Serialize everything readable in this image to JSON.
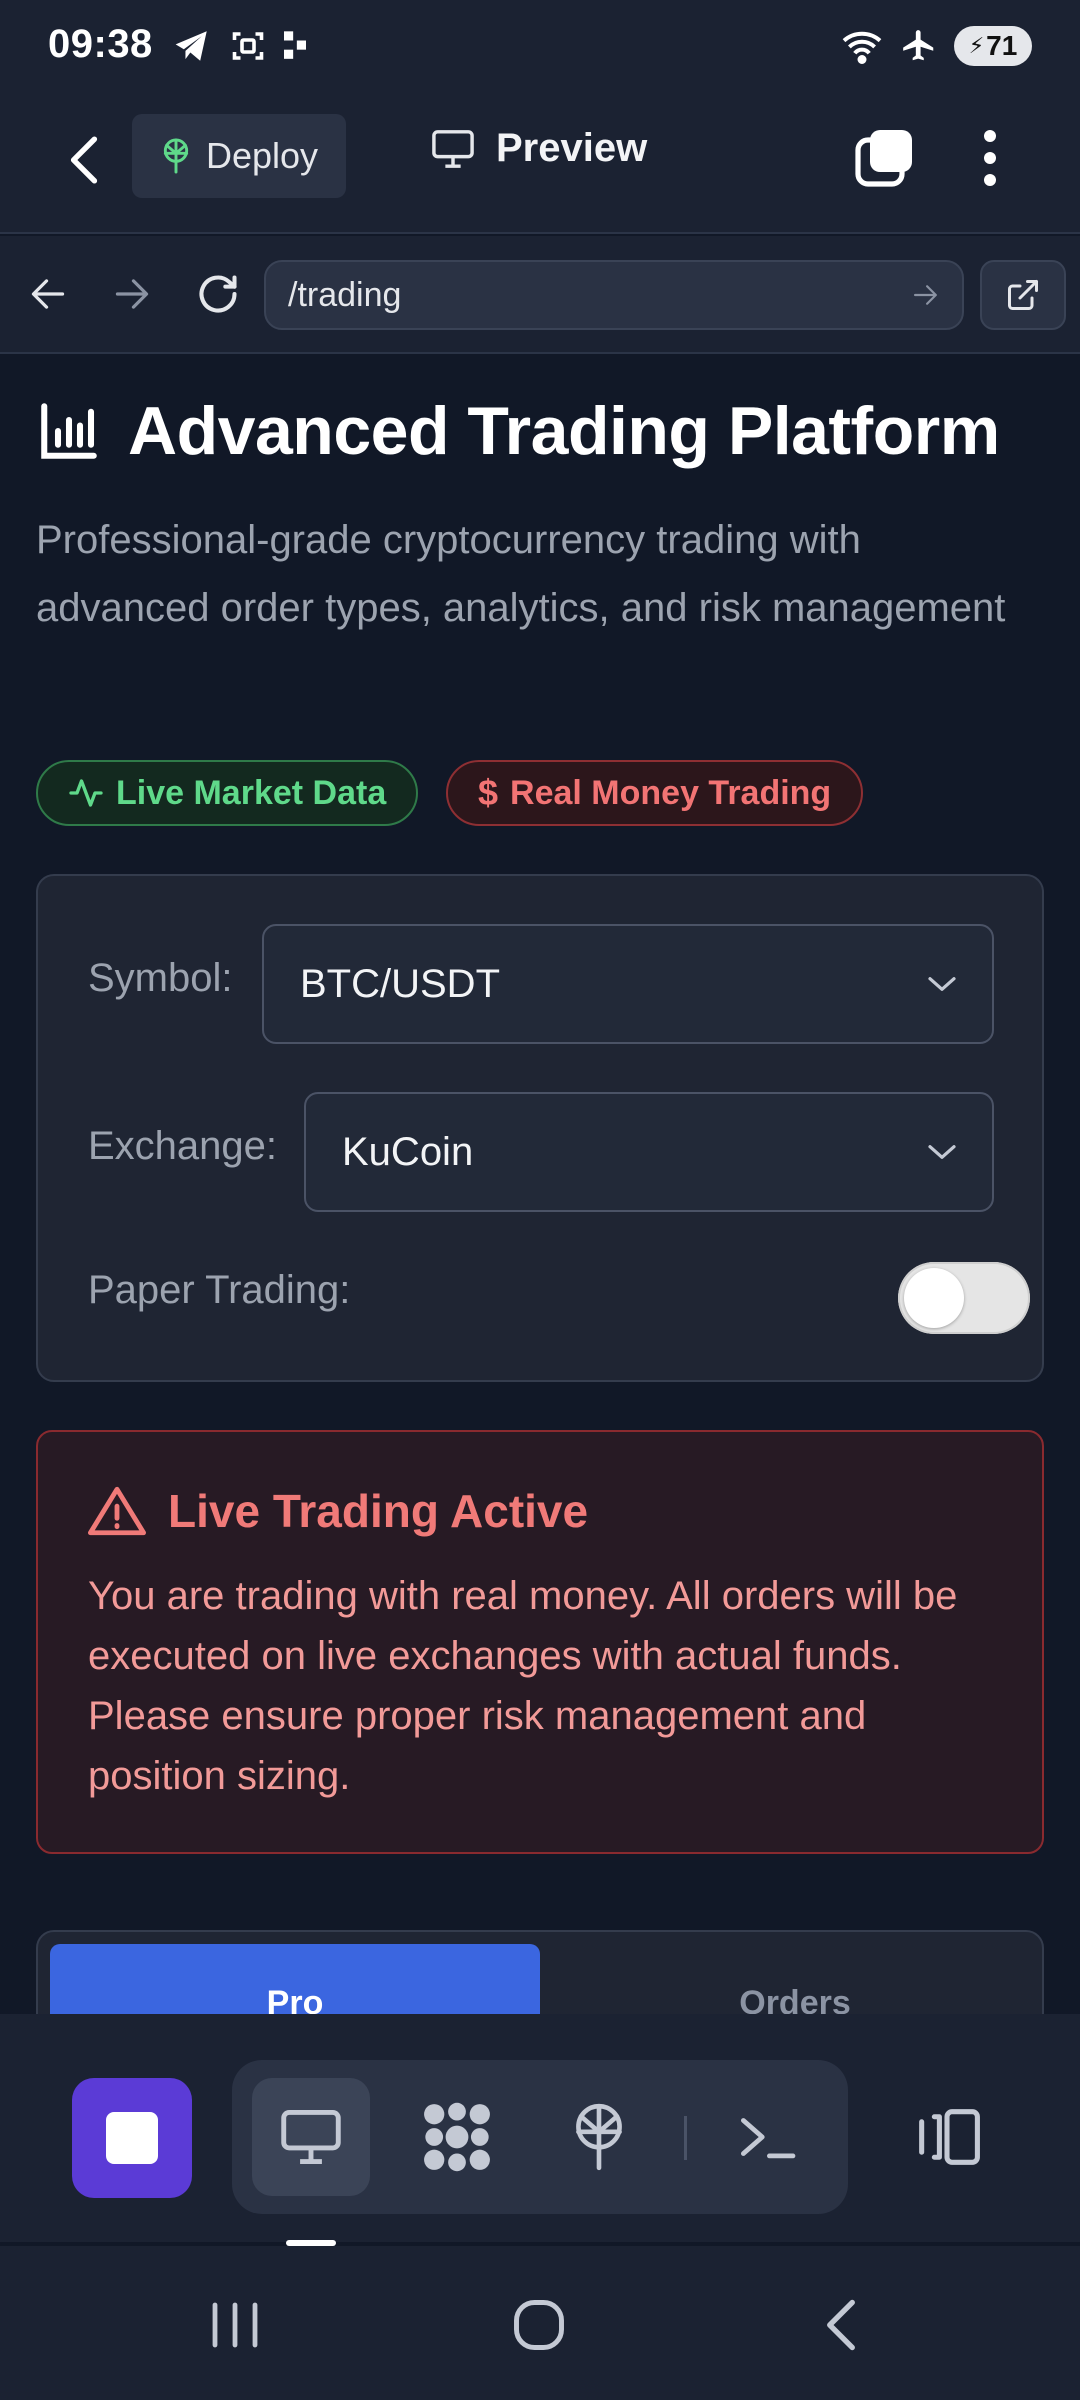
{
  "status_bar": {
    "time": "09:38",
    "battery": "71",
    "icons": [
      "telegram-icon",
      "screenshot-icon",
      "dots-icon",
      "wifi-icon",
      "airplane-icon",
      "battery-icon"
    ]
  },
  "header": {
    "deploy_label": "Deploy",
    "preview_label": "Preview"
  },
  "browser": {
    "url": "/trading"
  },
  "page": {
    "title": "Advanced Trading Platform",
    "subtitle": "Professional-grade cryptocurrency trading with advanced order types, analytics, and risk management",
    "badges": {
      "live": "Live Market Data",
      "money": "Real Money Trading"
    }
  },
  "settings": {
    "symbol_label": "Symbol:",
    "symbol_value": "BTC/USDT",
    "exchange_label": "Exchange:",
    "exchange_value": "KuCoin",
    "paper_label": "Paper Trading:",
    "paper_enabled": false
  },
  "alert": {
    "title": "Live Trading Active",
    "body": "You are trading with real money. All orders will be executed on live exchanges with actual funds. Please ensure proper risk management and position sizing."
  },
  "tabs": [
    {
      "label": "Pro",
      "active": true
    },
    {
      "label": "Orders",
      "active": false
    }
  ],
  "colors": {
    "accent_blue": "#3b66e0",
    "stop_purple": "#5b3bd6",
    "live_green": "#5fd98a",
    "danger_red": "#f07a78"
  }
}
